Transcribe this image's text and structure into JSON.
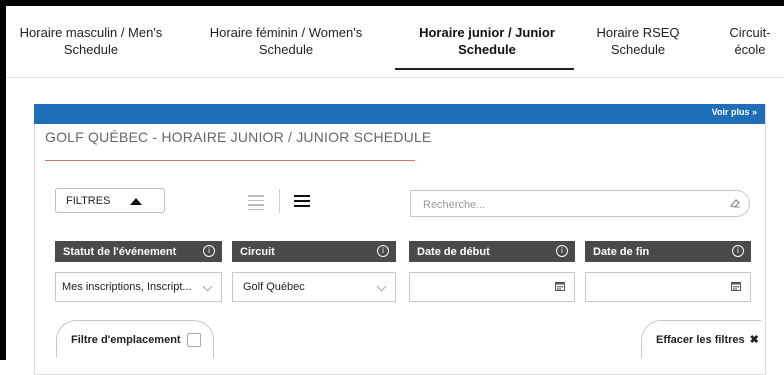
{
  "tabs": [
    {
      "label": "Horaire masculin / Men's Schedule",
      "active": false
    },
    {
      "label": "Horaire féminin / Women's Schedule",
      "active": false
    },
    {
      "label": "Horaire junior / Junior Schedule",
      "active": true
    },
    {
      "label": "Horaire RSEQ Schedule",
      "active": false
    },
    {
      "label": "Circuit-école",
      "active": false
    }
  ],
  "panel": {
    "voir_plus": "Voir plus »",
    "title": "GOLF QUÉBEC - HORAIRE JUNIOR / JUNIOR SCHEDULE"
  },
  "toolbar": {
    "filters_label": "FILTRES",
    "search_placeholder": "Recherche..."
  },
  "filters": {
    "status": {
      "label": "Statut de l'événement",
      "value": "Mes inscriptions, Inscript..."
    },
    "circuit": {
      "label": "Circuit",
      "value": "Golf Québec"
    },
    "start_date": {
      "label": "Date de début",
      "value": ""
    },
    "end_date": {
      "label": "Date de fin",
      "value": ""
    }
  },
  "actions": {
    "location_filter": "Filtre d'emplacement",
    "clear_filters": "Effacer les filtres"
  },
  "colors": {
    "accent_blue": "#1e6fb8",
    "label_bar": "#4a4a4a",
    "title_underline": "#c0392b"
  }
}
